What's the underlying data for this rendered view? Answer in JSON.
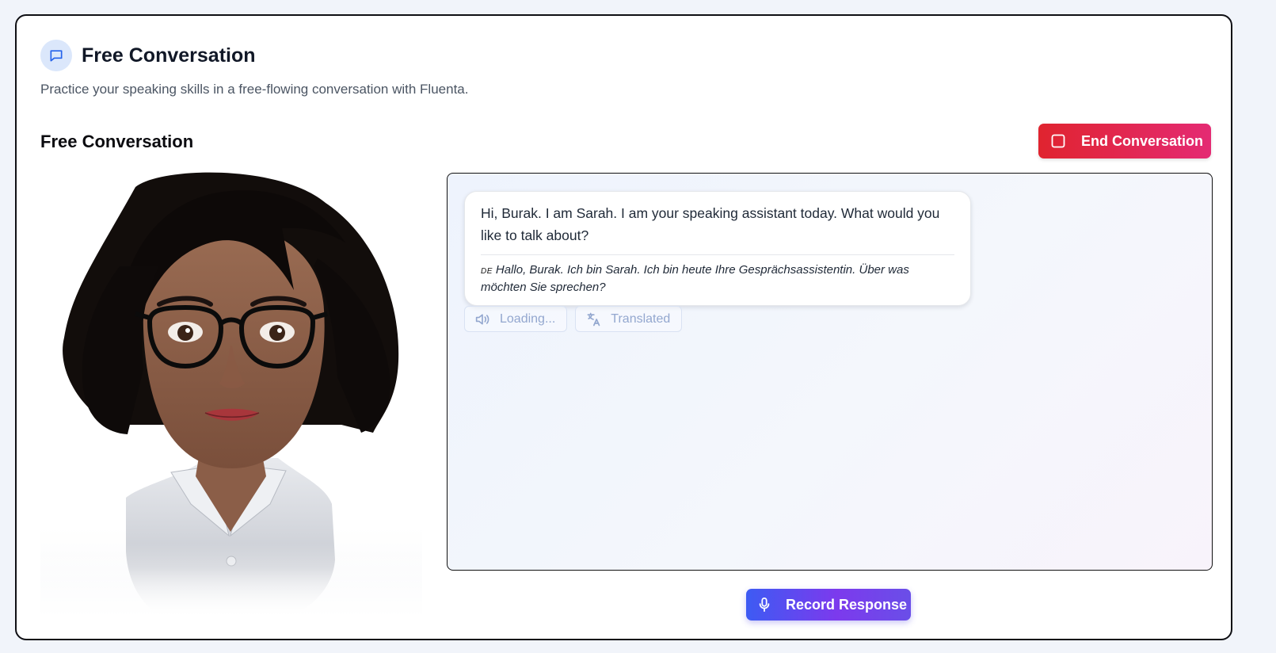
{
  "page": {
    "title": "Free Conversation",
    "subtitle": "Practice your speaking skills in a free-flowing conversation with Fluenta.",
    "title_icon": "chat-bubble-icon"
  },
  "session": {
    "title": "Free Conversation",
    "end_button_label": "End Conversation",
    "end_button_icon": "stop-square-icon"
  },
  "avatar": {
    "name": "Sarah"
  },
  "chat": {
    "messages": [
      {
        "text": "Hi, Burak. I am Sarah. I am your speaking assistant today. What would you like to talk about?",
        "translation_lang": "DE",
        "translation": "Hallo, Burak. Ich bin Sarah. Ich bin heute Ihre Gesprächsassistentin. Über was möchten Sie sprechen?"
      }
    ],
    "actions": {
      "audio_label": "Loading...",
      "audio_icon": "speaker-icon",
      "translate_label": "Translated",
      "translate_icon": "translate-icon"
    }
  },
  "record": {
    "label": "Record Response",
    "icon": "microphone-icon"
  },
  "colors": {
    "danger_gradient": [
      "#e0242f",
      "#e42a73"
    ],
    "record_gradient": [
      "#3d5bf3",
      "#7c3aed"
    ],
    "muted_action": "#93a7cf"
  }
}
